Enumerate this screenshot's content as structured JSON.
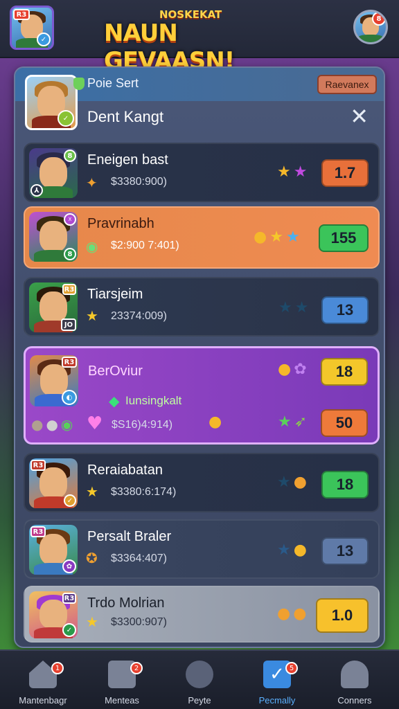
{
  "header": {
    "logo_top": "NOSKEKAT",
    "logo_main": "NAUN GEVAASN!",
    "left_avatar_badge": "R3",
    "right_avatar_badge": "8"
  },
  "panel": {
    "subtitle": "Poie Sert",
    "release_button": "Raevanex",
    "title": "Dent Kangt",
    "close_icon": "✕"
  },
  "rows": [
    {
      "name": "Eneigen bast",
      "value": "$3380:900)",
      "score": "1.7",
      "score_color": "#e8703a",
      "avatar_badge_top": "8",
      "avatar_badge_bottom": "⅄"
    },
    {
      "name": "Pravrinabh",
      "value": "$2:900 7:401)",
      "score": "155",
      "score_color": "#3bc45a",
      "avatar_badge_top": "☓",
      "avatar_badge_bottom": "8"
    },
    {
      "name": "Tiarsjeim",
      "value": "23374:009)",
      "score": "13",
      "score_color": "#4a8ad8",
      "avatar_badge_top": "R3",
      "avatar_badge_bottom": "JO"
    },
    {
      "name": "BerOviur",
      "value": "$S16)4:914)",
      "score": "18",
      "score_color": "#f3c72a",
      "score2": "50",
      "score2_color": "#ee7a3a",
      "sub_label": "Iunsingkalt",
      "avatar_badge_top": "R3",
      "avatar_badge_bottom": "◐"
    },
    {
      "name": "Reraiabatan",
      "value": "$3380:6:174)",
      "score": "18",
      "score_color": "#3bc45a",
      "avatar_badge_top": "R3",
      "avatar_badge_bottom": "✓"
    },
    {
      "name": "Persalt Braler",
      "value": "$3364:407)",
      "score": "13",
      "score_color": "#5f7aa8",
      "avatar_badge_top": "R3",
      "avatar_badge_bottom": "✿"
    },
    {
      "name": "Trdo Molrian",
      "value": "$3300:907)",
      "score": "1.0",
      "score_color": "#f7c12c",
      "avatar_badge_top": "R3",
      "avatar_badge_bottom": "✓"
    }
  ],
  "nav": [
    {
      "label": "Mantenbagr",
      "badge": "1",
      "icon": "home-icon"
    },
    {
      "label": "Menteas",
      "badge": "2",
      "icon": "chat-icon"
    },
    {
      "label": "Peyte",
      "badge": "",
      "icon": "clover-icon"
    },
    {
      "label": "Pecmally",
      "badge": "5",
      "icon": "check-icon"
    },
    {
      "label": "Conners",
      "badge": "",
      "icon": "person-icon"
    }
  ]
}
